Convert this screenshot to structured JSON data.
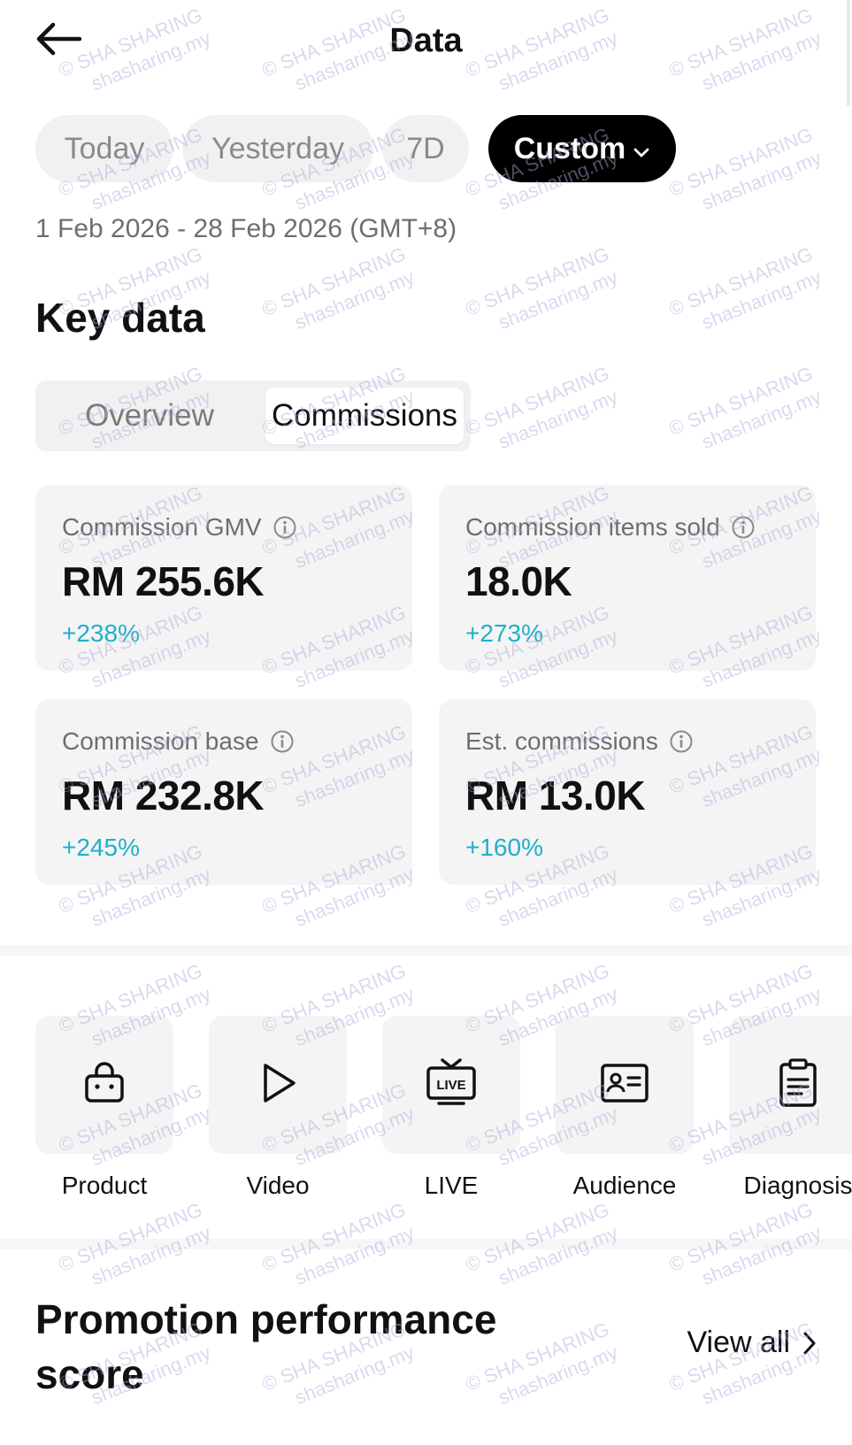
{
  "header": {
    "title": "Data",
    "back_icon": "arrow-left-icon"
  },
  "date_filters": {
    "options": [
      "Today",
      "Yesterday",
      "7D",
      "Custom"
    ],
    "selected": "Custom",
    "range_text": "1 Feb 2026 - 28 Feb 2026 (GMT+8)"
  },
  "key_data": {
    "title": "Key data",
    "tabs": [
      "Overview",
      "Commissions"
    ],
    "selected_tab": "Commissions",
    "metrics": [
      {
        "label": "Commission GMV",
        "value": "RM 255.6K",
        "change": "+238%"
      },
      {
        "label": "Commission items sold",
        "value": "18.0K",
        "change": "+273%"
      },
      {
        "label": "Commission base",
        "value": "RM 232.8K",
        "change": "+245%"
      },
      {
        "label": "Est. commissions",
        "value": "RM 13.0K",
        "change": "+160%"
      }
    ]
  },
  "shortcuts": [
    {
      "label": "Product",
      "icon": "shopping-bag-icon"
    },
    {
      "label": "Video",
      "icon": "play-icon"
    },
    {
      "label": "LIVE",
      "icon": "live-tv-icon"
    },
    {
      "label": "Audience",
      "icon": "id-card-icon"
    },
    {
      "label": "Diagnosis",
      "icon": "clipboard-icon"
    }
  ],
  "promotion": {
    "title": "Promotion performance score",
    "view_all": "View all"
  },
  "watermark": {
    "line1": "© SHA SHARING",
    "line2": "shasharing.my"
  },
  "colors": {
    "positive_change": "#1fb0c9",
    "selected_pill": "#000000",
    "card_background": "#f4f4f4"
  }
}
